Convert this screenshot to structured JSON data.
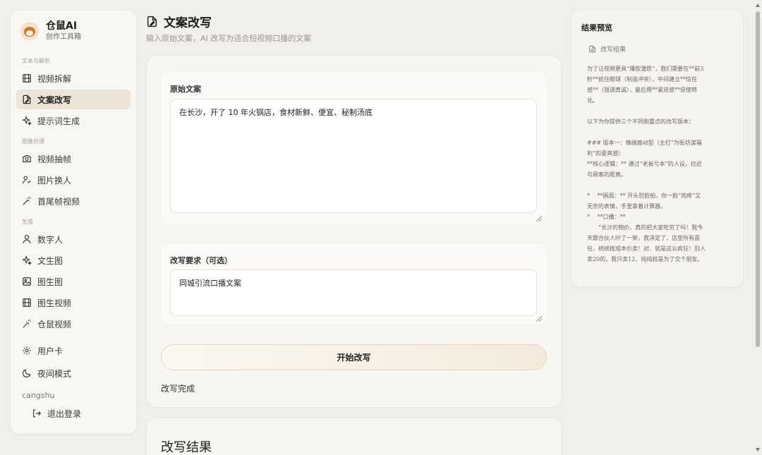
{
  "brand": {
    "title": "仓鼠AI",
    "subtitle": "创作工具箱"
  },
  "sidebar": {
    "groups": [
      {
        "label": "文本与解析",
        "items": [
          {
            "label": "视频拆解",
            "icon": "film-icon"
          },
          {
            "label": "文案改写",
            "icon": "document-edit-icon",
            "active": true
          },
          {
            "label": "提示词生成",
            "icon": "sparkles-icon"
          }
        ]
      },
      {
        "label": "图像处理",
        "items": [
          {
            "label": "视频抽帧",
            "icon": "camera-icon"
          },
          {
            "label": "图片换人",
            "icon": "user-swap-icon"
          },
          {
            "label": "首尾帧视频",
            "icon": "magic-wand-icon"
          }
        ]
      },
      {
        "label": "生成",
        "items": [
          {
            "label": "数字人",
            "icon": "user-icon"
          },
          {
            "label": "文生图",
            "icon": "sparkles-icon"
          },
          {
            "label": "图生图",
            "icon": "image-icon"
          },
          {
            "label": "图生视频",
            "icon": "film-icon"
          },
          {
            "label": "仓鼠视频",
            "icon": "magic-wand-icon"
          }
        ]
      }
    ],
    "bottom_items": [
      {
        "label": "用户卡",
        "icon": "gear-icon"
      },
      {
        "label": "夜间模式",
        "icon": "moon-icon"
      }
    ],
    "username": "cangshu",
    "logout_label": "退出登录"
  },
  "page": {
    "title": "文案改写",
    "description": "输入原始文案，AI 改写为适合短视频口播的文案"
  },
  "form": {
    "source_label": "原始文案",
    "source_value": "在长沙，开了 10 年火锅店，食材新鲜、便宜、秘制汤底",
    "requirement_label": "改写要求（可选）",
    "requirement_value": "同城引流口播文案",
    "submit_label": "开始改写",
    "status": "改写完成"
  },
  "result": {
    "title": "改写结果"
  },
  "preview": {
    "title": "结果预览",
    "file_label": "改写结果",
    "paragraphs": [
      [
        "为了让视频更具“爆款潜质”，我们需要在**前3",
        "秒**抓住眼球（制造冲突），中间建立**信任",
        "感**（强调真诚），最后用**紧迫感**促使转",
        "化。"
      ],
      [
        "以下为你提供三个不同侧重点的改写版本："
      ],
      [
        "### 版本一：情绪煽动型（主打“为街坊谋福",
        "利”的豪爽感）",
        "**核心逻辑：** 通过“老板亏本”的人设，拉近",
        "与顾客的距离。"
      ],
      [
        "*　 **画面：** 开头怼脸拍，你一脸“肉疼”又",
        "无奈的表情，手里拿着计算器。",
        "*　 **口播：**",
        "　　“长沙的物价，真的把大家吃穷了吗！我今",
        "天跟合伙人吵了一架，我决定了，店里所有面",
        "包，统统按成本价卖！对，就是这么疯狂！别人",
        "卖20的，我只卖12，纯纯就是为了交个朋友。"
      ]
    ]
  },
  "colors": {
    "background": "#f1efeb",
    "active_item": "#ece4d6",
    "button_gradient_end": "#f3eadb"
  }
}
